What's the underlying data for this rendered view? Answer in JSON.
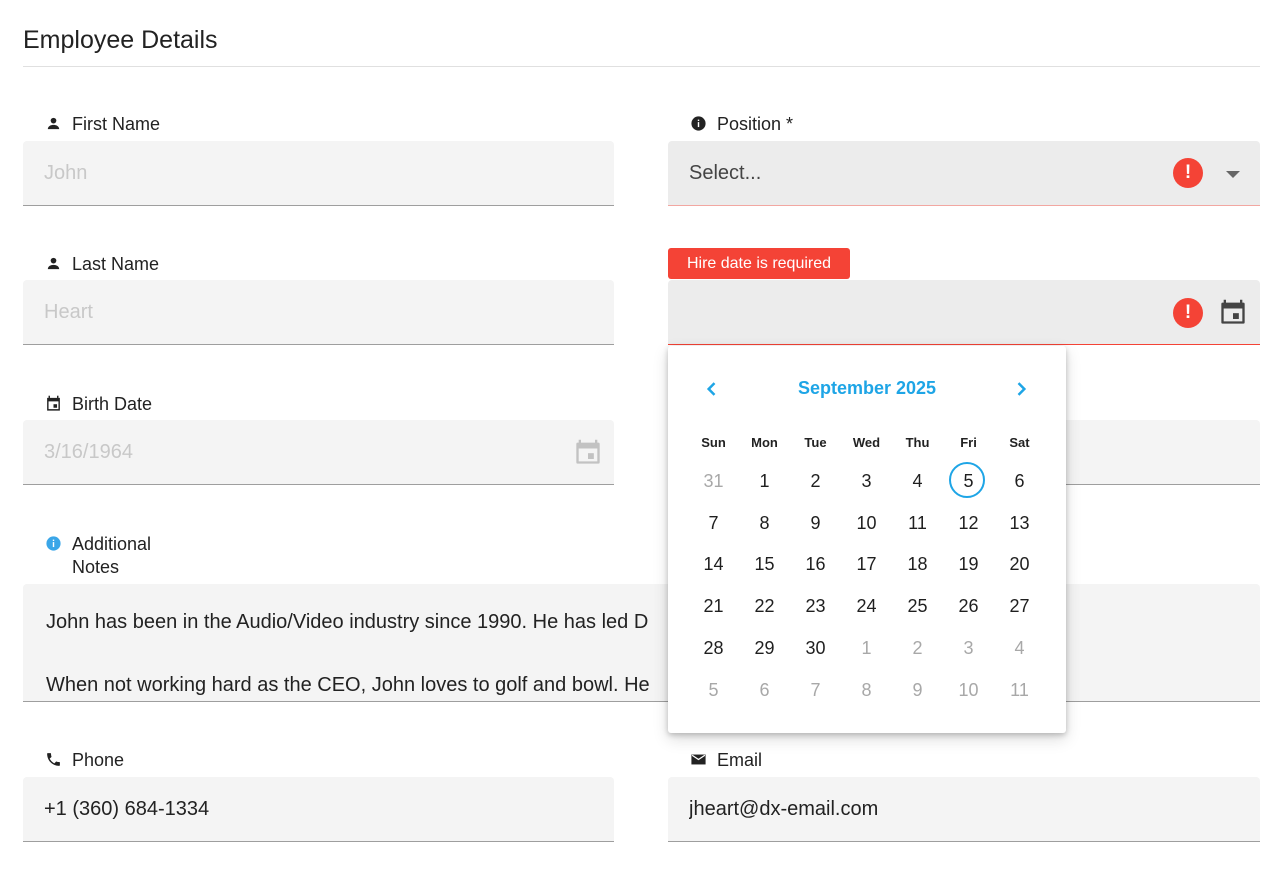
{
  "page": {
    "title": "Employee Details"
  },
  "form": {
    "first_name": {
      "label": "First Name",
      "value": "John"
    },
    "last_name": {
      "label": "Last Name",
      "value": "Heart"
    },
    "birth_date": {
      "label": "Birth Date",
      "value": "3/16/1964"
    },
    "position": {
      "label": "Position *",
      "placeholder": "Select..."
    },
    "hire_date": {
      "error": "Hire date is required",
      "value": ""
    },
    "notes": {
      "label_line1": "Additional",
      "label_line2": "Notes",
      "line1": "John has been in the Audio/Video industry since 1990. He has led D",
      "line2": "When not working hard as the CEO, John loves to golf and bowl. He"
    },
    "phone": {
      "label": "Phone",
      "value": "+1 (360) 684-1334"
    },
    "email": {
      "label": "Email",
      "value": "jheart@dx-email.com"
    }
  },
  "calendar": {
    "month_label": "September 2025",
    "weekdays": [
      "Sun",
      "Mon",
      "Tue",
      "Wed",
      "Thu",
      "Fri",
      "Sat"
    ],
    "weeks": [
      [
        "31",
        "1",
        "2",
        "3",
        "4",
        "5",
        "6"
      ],
      [
        "7",
        "8",
        "9",
        "10",
        "11",
        "12",
        "13"
      ],
      [
        "14",
        "15",
        "16",
        "17",
        "18",
        "19",
        "20"
      ],
      [
        "21",
        "22",
        "23",
        "24",
        "25",
        "26",
        "27"
      ],
      [
        "28",
        "29",
        "30",
        "1",
        "2",
        "3",
        "4"
      ],
      [
        "5",
        "6",
        "7",
        "8",
        "9",
        "10",
        "11"
      ]
    ],
    "today": "5",
    "accent_color": "#1ea5e6"
  },
  "icons": {
    "first_name": "person-icon",
    "last_name": "person-icon",
    "birth_date": "event-icon",
    "position": "info-icon",
    "notes": "info-icon",
    "phone": "phone-icon",
    "email": "mail-icon"
  },
  "colors": {
    "error": "#f44336",
    "accent": "#1ea5e6"
  }
}
